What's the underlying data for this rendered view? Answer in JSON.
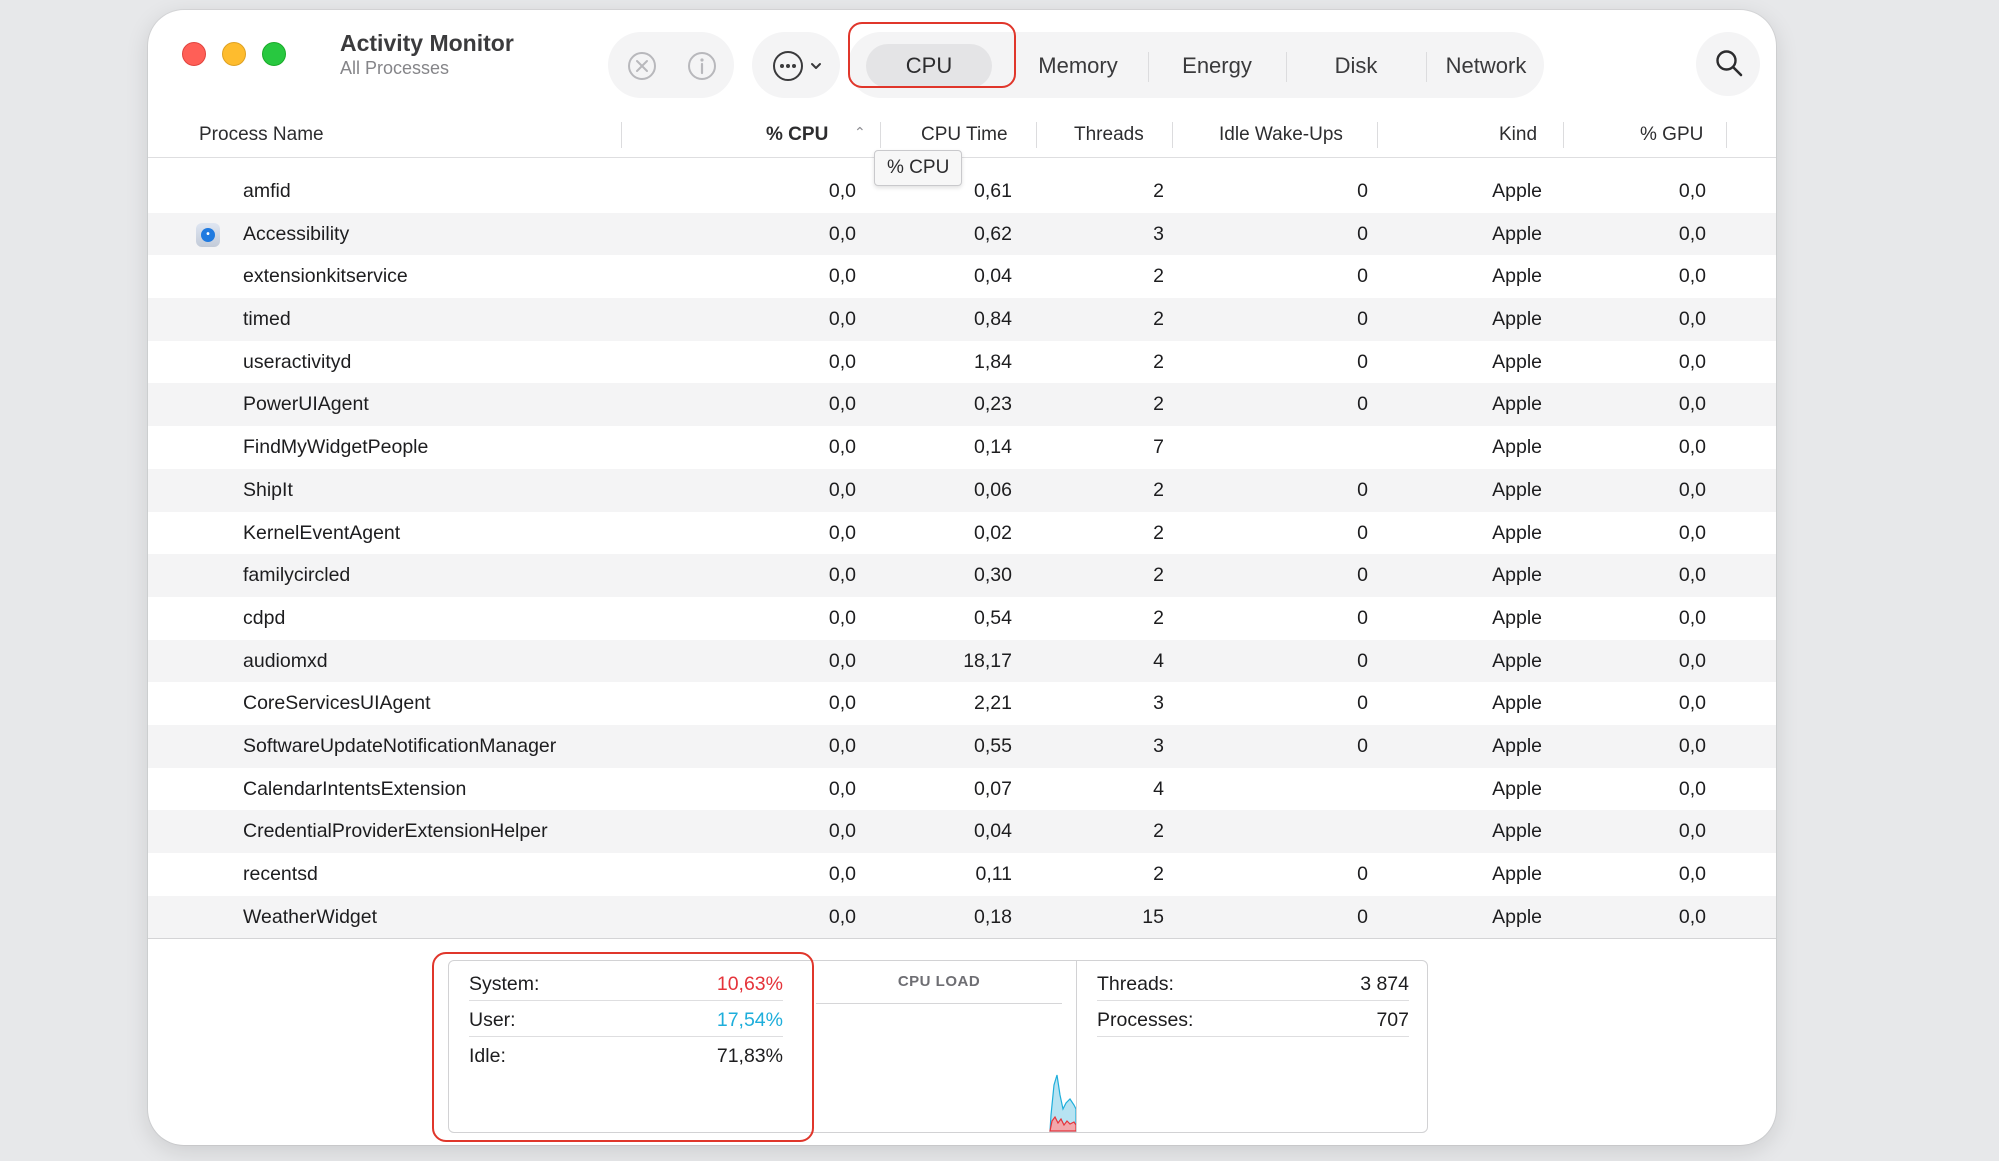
{
  "window": {
    "title": "Activity Monitor",
    "subtitle": "All Processes"
  },
  "toolbar": {
    "stop_icon": "x-circle-icon",
    "info_icon": "info-icon",
    "more_icon": "ellipsis-circle-icon",
    "search_icon": "magnifier-icon",
    "tabs": [
      {
        "label": "CPU",
        "selected": true
      },
      {
        "label": "Memory",
        "selected": false
      },
      {
        "label": "Energy",
        "selected": false
      },
      {
        "label": "Disk",
        "selected": false
      },
      {
        "label": "Network",
        "selected": false
      }
    ]
  },
  "columns": {
    "name": "Process Name",
    "cpu": "% CPU",
    "cpu_time": "CPU Time",
    "threads": "Threads",
    "idle_wakeups": "Idle Wake-Ups",
    "kind": "Kind",
    "gpu": "% GPU"
  },
  "tooltip": "% CPU",
  "processes": [
    {
      "name": "amfid",
      "cpu": "0,0",
      "time": "0,61",
      "threads": "2",
      "wake": "0",
      "kind": "Apple",
      "gpu": "0,0",
      "icon": ""
    },
    {
      "name": "Accessibility",
      "cpu": "0,0",
      "time": "0,62",
      "threads": "3",
      "wake": "0",
      "kind": "Apple",
      "gpu": "0,0",
      "icon": "accessibility-icon"
    },
    {
      "name": "extensionkitservice",
      "cpu": "0,0",
      "time": "0,04",
      "threads": "2",
      "wake": "0",
      "kind": "Apple",
      "gpu": "0,0",
      "icon": ""
    },
    {
      "name": "timed",
      "cpu": "0,0",
      "time": "0,84",
      "threads": "2",
      "wake": "0",
      "kind": "Apple",
      "gpu": "0,0",
      "icon": ""
    },
    {
      "name": "useractivityd",
      "cpu": "0,0",
      "time": "1,84",
      "threads": "2",
      "wake": "0",
      "kind": "Apple",
      "gpu": "0,0",
      "icon": ""
    },
    {
      "name": "PowerUIAgent",
      "cpu": "0,0",
      "time": "0,23",
      "threads": "2",
      "wake": "0",
      "kind": "Apple",
      "gpu": "0,0",
      "icon": ""
    },
    {
      "name": "FindMyWidgetPeople",
      "cpu": "0,0",
      "time": "0,14",
      "threads": "7",
      "wake": "",
      "kind": "Apple",
      "gpu": "0,0",
      "icon": ""
    },
    {
      "name": "ShipIt",
      "cpu": "0,0",
      "time": "0,06",
      "threads": "2",
      "wake": "0",
      "kind": "Apple",
      "gpu": "0,0",
      "icon": ""
    },
    {
      "name": "KernelEventAgent",
      "cpu": "0,0",
      "time": "0,02",
      "threads": "2",
      "wake": "0",
      "kind": "Apple",
      "gpu": "0,0",
      "icon": ""
    },
    {
      "name": "familycircled",
      "cpu": "0,0",
      "time": "0,30",
      "threads": "2",
      "wake": "0",
      "kind": "Apple",
      "gpu": "0,0",
      "icon": ""
    },
    {
      "name": "cdpd",
      "cpu": "0,0",
      "time": "0,54",
      "threads": "2",
      "wake": "0",
      "kind": "Apple",
      "gpu": "0,0",
      "icon": ""
    },
    {
      "name": "audiomxd",
      "cpu": "0,0",
      "time": "18,17",
      "threads": "4",
      "wake": "0",
      "kind": "Apple",
      "gpu": "0,0",
      "icon": ""
    },
    {
      "name": "CoreServicesUIAgent",
      "cpu": "0,0",
      "time": "2,21",
      "threads": "3",
      "wake": "0",
      "kind": "Apple",
      "gpu": "0,0",
      "icon": ""
    },
    {
      "name": "SoftwareUpdateNotificationManager",
      "cpu": "0,0",
      "time": "0,55",
      "threads": "3",
      "wake": "0",
      "kind": "Apple",
      "gpu": "0,0",
      "icon": ""
    },
    {
      "name": "CalendarIntentsExtension",
      "cpu": "0,0",
      "time": "0,07",
      "threads": "4",
      "wake": "",
      "kind": "Apple",
      "gpu": "0,0",
      "icon": ""
    },
    {
      "name": "CredentialProviderExtensionHelper",
      "cpu": "0,0",
      "time": "0,04",
      "threads": "2",
      "wake": "",
      "kind": "Apple",
      "gpu": "0,0",
      "icon": ""
    },
    {
      "name": "recentsd",
      "cpu": "0,0",
      "time": "0,11",
      "threads": "2",
      "wake": "0",
      "kind": "Apple",
      "gpu": "0,0",
      "icon": ""
    },
    {
      "name": "WeatherWidget",
      "cpu": "0,0",
      "time": "0,18",
      "threads": "15",
      "wake": "0",
      "kind": "Apple",
      "gpu": "0,0",
      "icon": ""
    }
  ],
  "summary": {
    "system_label": "System:",
    "system_value": "10,63%",
    "user_label": "User:",
    "user_value": "17,54%",
    "idle_label": "Idle:",
    "idle_value": "71,83%",
    "cpu_load_title": "CPU LOAD",
    "threads_label": "Threads:",
    "threads_value": "3 874",
    "processes_label": "Processes:",
    "processes_value": "707"
  },
  "colors": {
    "system": "#e5333a",
    "user": "#1eaedb",
    "highlight": "#e0362b"
  }
}
